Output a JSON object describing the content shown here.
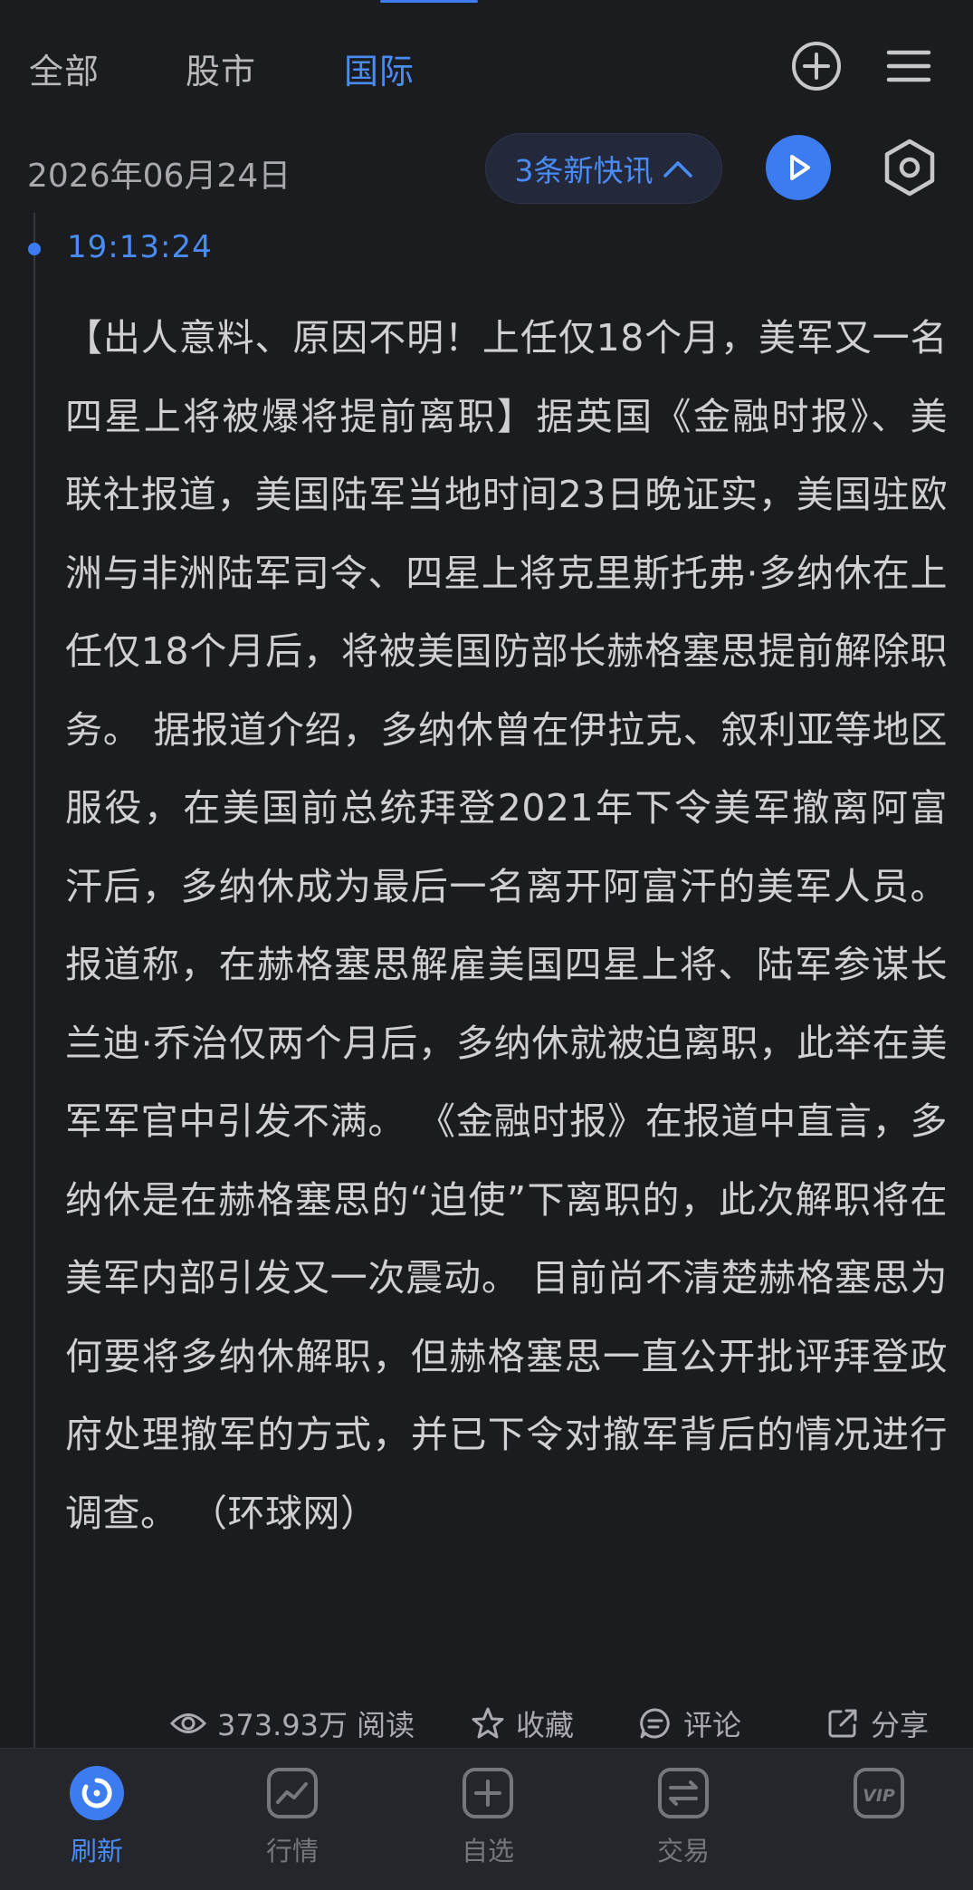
{
  "tabs": [
    {
      "label": "全部",
      "active": false
    },
    {
      "label": "股市",
      "active": false
    },
    {
      "label": "国际",
      "active": true
    }
  ],
  "header_icons": [
    "plus-circle-icon",
    "menu-icon"
  ],
  "date": "2026年06月24日",
  "new_flash": {
    "label": "3条新快讯",
    "icon": "chevron-up-icon"
  },
  "play_icon": "play-icon",
  "settings_icon": "hexagon-settings-icon",
  "item": {
    "time": "19:13:24",
    "content": "【出人意料、原因不明！上任仅18个月，美军又一名四星上将被爆将提前离职】据英国《金融时报》、美联社报道，美国陆军当地时间23日晚证实，美国驻欧洲与非洲陆军司令、四星上将克里斯托弗·多纳休在上任仅18个月后，将被美国防部长赫格塞思提前解除职务。 据报道介绍，多纳休曾在伊拉克、叙利亚等地区服役，在美国前总统拜登2021年下令美军撤离阿富汗后，多纳休成为最后一名离开阿富汗的美军人员。 报道称，在赫格塞思解雇美国四星上将、陆军参谋长兰迪·乔治仅两个月后，多纳休就被迫离职，此举在美军军官中引发不满。 《金融时报》在报道中直言，多纳休是在赫格塞思的“迫使”下离职的，此次解职将在美军内部引发又一次震动。 目前尚不清楚赫格塞思为何要将多纳休解职，但赫格塞思一直公开批评拜登政府处理撤军的方式，并已下令对撤军背后的情况进行调查。 （环球网）",
    "actions": {
      "reads": "373.93万 阅读",
      "favorite": "收藏",
      "comment": "评论",
      "share": "分享"
    }
  },
  "bottom_nav": [
    {
      "label": "刷新",
      "active": true
    },
    {
      "label": "行情",
      "active": false
    },
    {
      "label": "自选",
      "active": false
    },
    {
      "label": "交易",
      "active": false
    },
    {
      "label": "VIP",
      "active": false
    }
  ],
  "colors": {
    "accent": "#3d7cf0",
    "background": "#1b1c20",
    "nav_background": "#25262b"
  }
}
